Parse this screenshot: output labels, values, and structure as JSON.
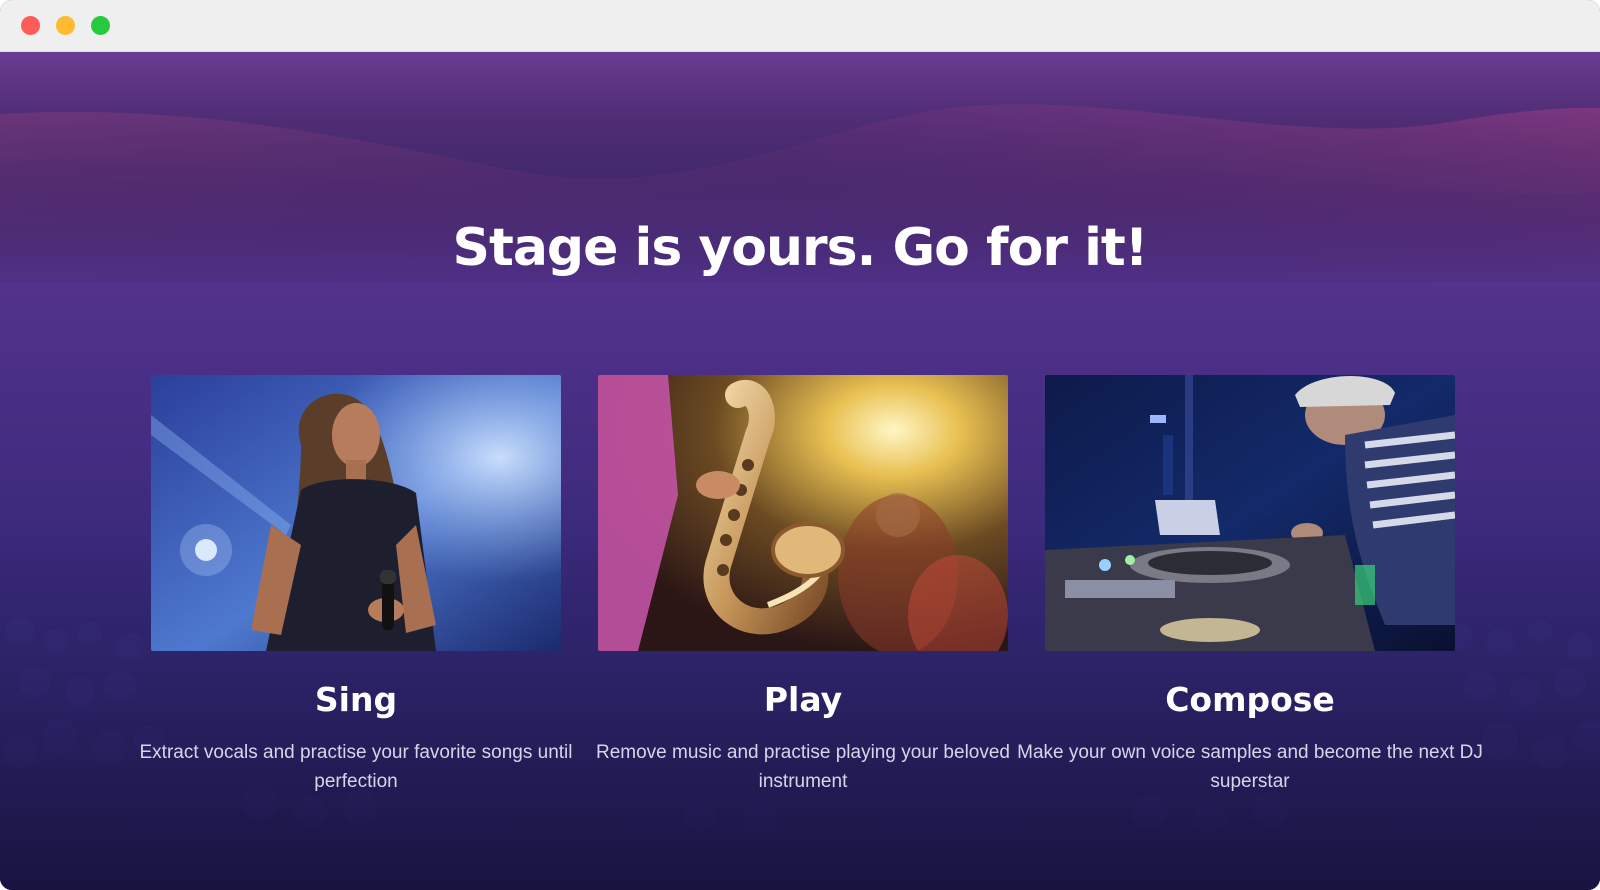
{
  "window": {
    "controls": {
      "close_color": "#fd5c57",
      "minimize_color": "#fdbb2d",
      "zoom_color": "#27c93f"
    }
  },
  "hero": {
    "headline": "Stage is yours. Go for it!"
  },
  "features": [
    {
      "title": "Sing",
      "description": "Extract vocals and practise your favorite songs until perfection",
      "image": "singer-photo"
    },
    {
      "title": "Play",
      "description": "Remove music and practise playing your beloved instrument",
      "image": "saxophone-photo"
    },
    {
      "title": "Compose",
      "description": "Make your own voice samples and become the next DJ superstar",
      "image": "dj-turntable-photo"
    }
  ],
  "colors": {
    "background_top": "#6c3b93",
    "background_bottom": "#1f1a50",
    "wave_accent": "#a54a9e",
    "text_primary": "#ffffff",
    "text_secondary": "#d9d4ea"
  }
}
